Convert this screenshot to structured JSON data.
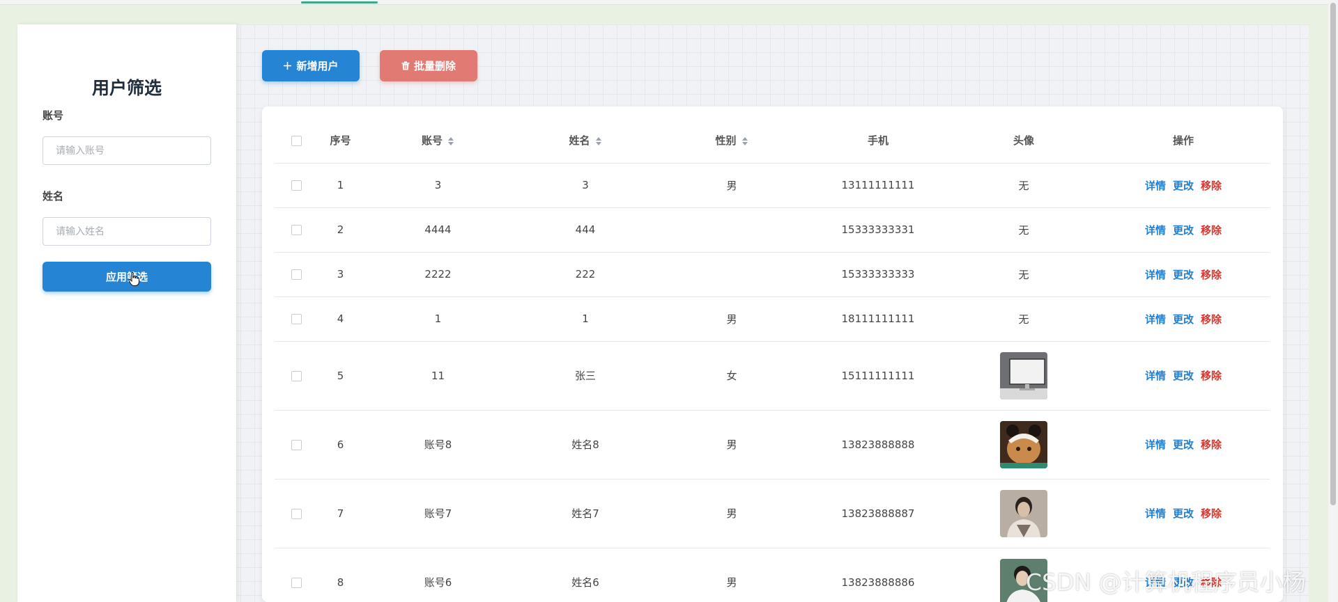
{
  "sidebar": {
    "title": "用户筛选",
    "account_label": "账号",
    "account_placeholder": "请输入账号",
    "name_label": "姓名",
    "name_placeholder": "请输入姓名",
    "apply_label": "应用筛选"
  },
  "toolbar": {
    "add_label": "新增用户",
    "delete_label": "批量删除"
  },
  "table": {
    "columns": {
      "index": "序号",
      "account": "账号",
      "name": "姓名",
      "gender": "性别",
      "phone": "手机",
      "avatar": "头像",
      "actions": "操作"
    },
    "action_labels": {
      "detail": "详情",
      "edit": "更改",
      "remove": "移除"
    },
    "rows": [
      {
        "index": "1",
        "account": "3",
        "name": "3",
        "gender": "男",
        "phone": "13111111111",
        "avatar_text": "无"
      },
      {
        "index": "2",
        "account": "4444",
        "name": "444",
        "gender": "",
        "phone": "15333333331",
        "avatar_text": "无"
      },
      {
        "index": "3",
        "account": "2222",
        "name": "222",
        "gender": "",
        "phone": "15333333333",
        "avatar_text": "无"
      },
      {
        "index": "4",
        "account": "1",
        "name": "1",
        "gender": "男",
        "phone": "18111111111",
        "avatar_text": "无"
      },
      {
        "index": "5",
        "account": "11",
        "name": "张三",
        "gender": "女",
        "phone": "15111111111",
        "avatar_text": "",
        "avatar_caption": "STUDY ATSTUD"
      },
      {
        "index": "6",
        "account": "账号8",
        "name": "姓名8",
        "gender": "男",
        "phone": "13823888888",
        "avatar_text": ""
      },
      {
        "index": "7",
        "account": "账号7",
        "name": "姓名7",
        "gender": "男",
        "phone": "13823888887",
        "avatar_text": ""
      },
      {
        "index": "8",
        "account": "账号6",
        "name": "姓名6",
        "gender": "男",
        "phone": "13823888886",
        "avatar_text": ""
      }
    ]
  },
  "watermark": "CSDN @计算机程序员小杨",
  "colors": {
    "primary": "#2684d4",
    "danger_button": "#e07a73",
    "link": "#2380d0",
    "remove_link": "#d9352c"
  }
}
